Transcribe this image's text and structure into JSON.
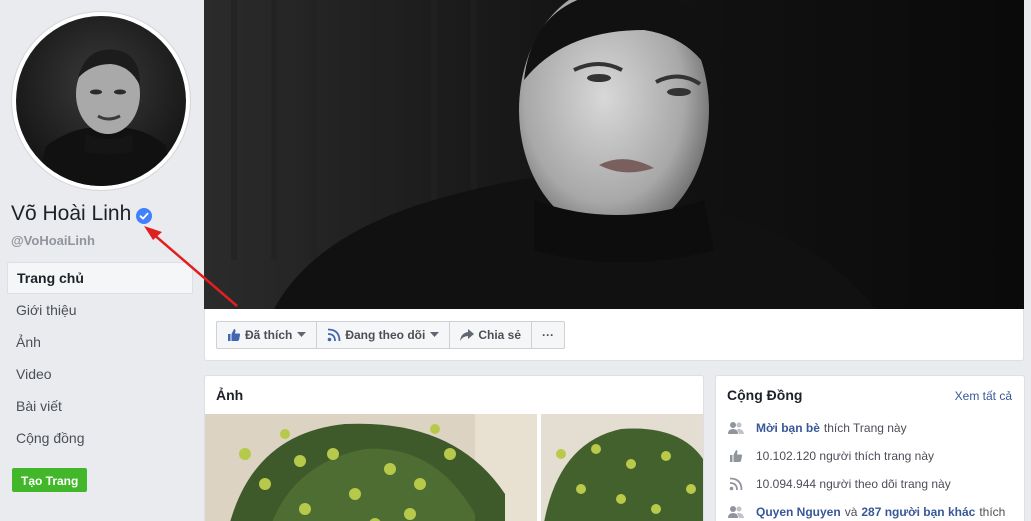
{
  "profile": {
    "name": "Võ Hoài Linh",
    "username": "@VoHoaiLinh"
  },
  "nav": {
    "items": [
      {
        "label": "Trang chủ",
        "active": true
      },
      {
        "label": "Giới thiệu"
      },
      {
        "label": "Ảnh"
      },
      {
        "label": "Video"
      },
      {
        "label": "Bài viết"
      },
      {
        "label": "Cộng đồng"
      }
    ],
    "create_page": "Tạo Trang"
  },
  "actions": {
    "liked": "Đã thích",
    "following": "Đang theo dõi",
    "share": "Chia sẻ",
    "more": "···"
  },
  "photos": {
    "title": "Ảnh"
  },
  "community": {
    "title": "Cộng Đồng",
    "see_all": "Xem tất cả",
    "invite_link": "Mời bạn bè",
    "invite_rest": "thích Trang này",
    "likes": "10.102.120 người thích trang này",
    "follows": "10.094.944 người theo dõi trang này",
    "friend_name": "Quyen Nguyen",
    "friend_and": "và",
    "friend_count": "287 người bạn khác",
    "friend_rest": "thích"
  },
  "colors": {
    "accent_blue": "#385898",
    "verified_blue": "#4080ff",
    "create_green": "#42b72a",
    "arrow_red": "#e02020"
  }
}
